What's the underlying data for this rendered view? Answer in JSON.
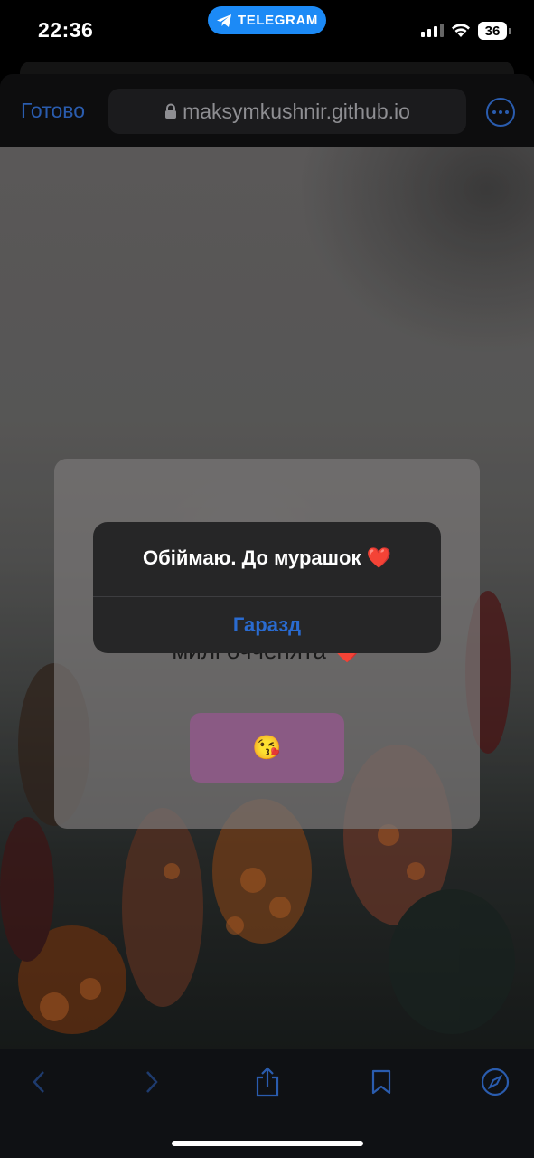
{
  "status_bar": {
    "time": "22:36",
    "app_pill": "TELEGRAM",
    "battery": "36"
  },
  "browser": {
    "done_label": "Готово",
    "url": "maksymkushnir.github.io"
  },
  "card": {
    "message": "милі очченята",
    "message_emoji": "❤️",
    "button_emoji": "😘"
  },
  "alert": {
    "message": "Обіймаю. До мурашок",
    "message_emoji": "❤️",
    "ok_label": "Гаразд"
  },
  "colors": {
    "accent": "#2a6bd0",
    "telegram": "#1c8af6",
    "kiss_button": "#8a5a84"
  },
  "toolbar": {
    "icons": [
      "back-icon",
      "forward-icon",
      "share-icon",
      "bookmarks-icon",
      "compass-icon"
    ]
  }
}
